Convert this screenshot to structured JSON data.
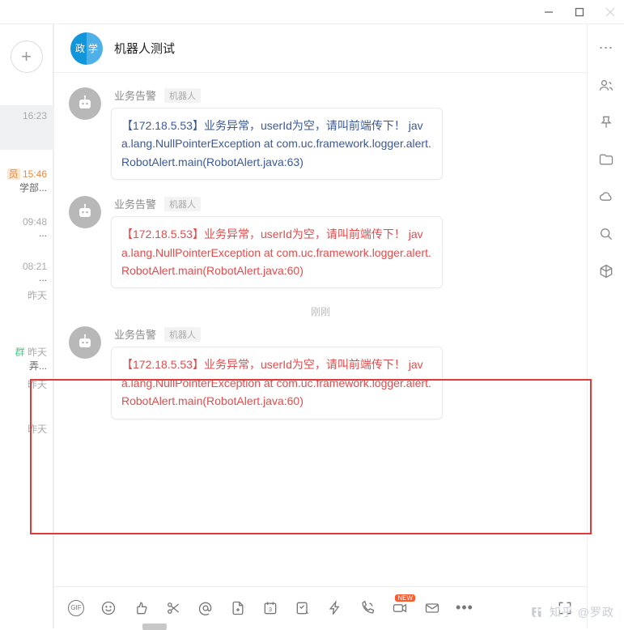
{
  "window": {
    "minimize_icon": "minimize",
    "maximize_icon": "maximize",
    "close_icon": "close"
  },
  "sidebar_left": {
    "add_label": "+",
    "more_label": "•••"
  },
  "chat_list_sliver": [
    {
      "time": "16:23",
      "text": "",
      "active": true
    },
    {
      "time": "15:46",
      "text": "学部..."
    },
    {
      "time": "09:48",
      "text": "..."
    },
    {
      "time": "08:21",
      "text": "..."
    },
    {
      "time": "昨天",
      "text": ""
    },
    {
      "time": "昨天",
      "text": "弄..."
    },
    {
      "time": "昨天",
      "text": ""
    },
    {
      "time": "昨天",
      "text": ""
    }
  ],
  "header": {
    "avatar_left": "政",
    "avatar_right": "学",
    "title": "机器人测试"
  },
  "messages": [
    {
      "sender": "业务告警",
      "role": "机器人",
      "color": "blue",
      "text": "【172.18.5.53】业务异常，userId为空，请叫前端传下！  java.lang.NullPointerException at com.uc.framework.logger.alert.RobotAlert.main(RobotAlert.java:63)"
    },
    {
      "sender": "业务告警",
      "role": "机器人",
      "color": "red",
      "text": "【172.18.5.53】业务异常，userId为空，请叫前端传下！  java.lang.NullPointerException at com.uc.framework.logger.alert.RobotAlert.main(RobotAlert.java:60)"
    },
    {
      "divider": "刚刚"
    },
    {
      "sender": "业务告警",
      "role": "机器人",
      "color": "red",
      "highlighted": true,
      "text": "【172.18.5.53】业务异常，userId为空，请叫前端传下！  java.lang.NullPointerException at com.uc.framework.logger.alert.RobotAlert.main(RobotAlert.java:60)"
    }
  ],
  "footer_icons": {
    "gif": "GIF",
    "new_badge": "NEW",
    "more": "•••"
  },
  "watermark": "知乎 @罗政"
}
